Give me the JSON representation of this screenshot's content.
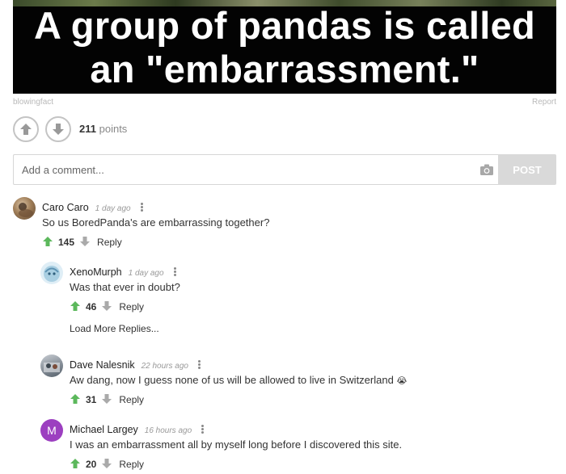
{
  "banner": {
    "line1": "A group of pandas is called",
    "line2": "an \"embarrassment.\""
  },
  "post": {
    "source": "blowingfact",
    "report_label": "Report",
    "points_value": "211",
    "points_label": "points"
  },
  "comment_form": {
    "placeholder": "Add a comment...",
    "post_label": "POST"
  },
  "comments": [
    {
      "name": "Caro Caro",
      "time": "1 day ago",
      "text": "So us BoredPanda's are embarrassing together?",
      "votes": "145",
      "reply_label": "Reply",
      "avatar_color": "#8a6a4a"
    },
    {
      "name": "XenoMurph",
      "time": "1 day ago",
      "text": "Was that ever in doubt?",
      "votes": "46",
      "reply_label": "Reply",
      "avatar_color": "#9cc6dc"
    },
    {
      "name": "Dave Nalesnik",
      "time": "22 hours ago",
      "text": "Aw dang, now I guess none of us will be allowed to live in Switzerland",
      "emoji": "😭",
      "votes": "31",
      "reply_label": "Reply",
      "avatar_color": "#7b8794"
    },
    {
      "name": "Michael Largey",
      "time": "16 hours ago",
      "text": "I was an embarrassment all by myself long before I discovered this site.",
      "votes": "20",
      "reply_label": "Reply",
      "avatar_letter": "M",
      "avatar_color": "#9c3fc0"
    }
  ],
  "load_more_label": "Load More Replies...",
  "colors": {
    "upvote_green": "#5cb85c",
    "downvote_gray": "#aaaaaa",
    "post_button_bg": "#d9d9d9"
  }
}
